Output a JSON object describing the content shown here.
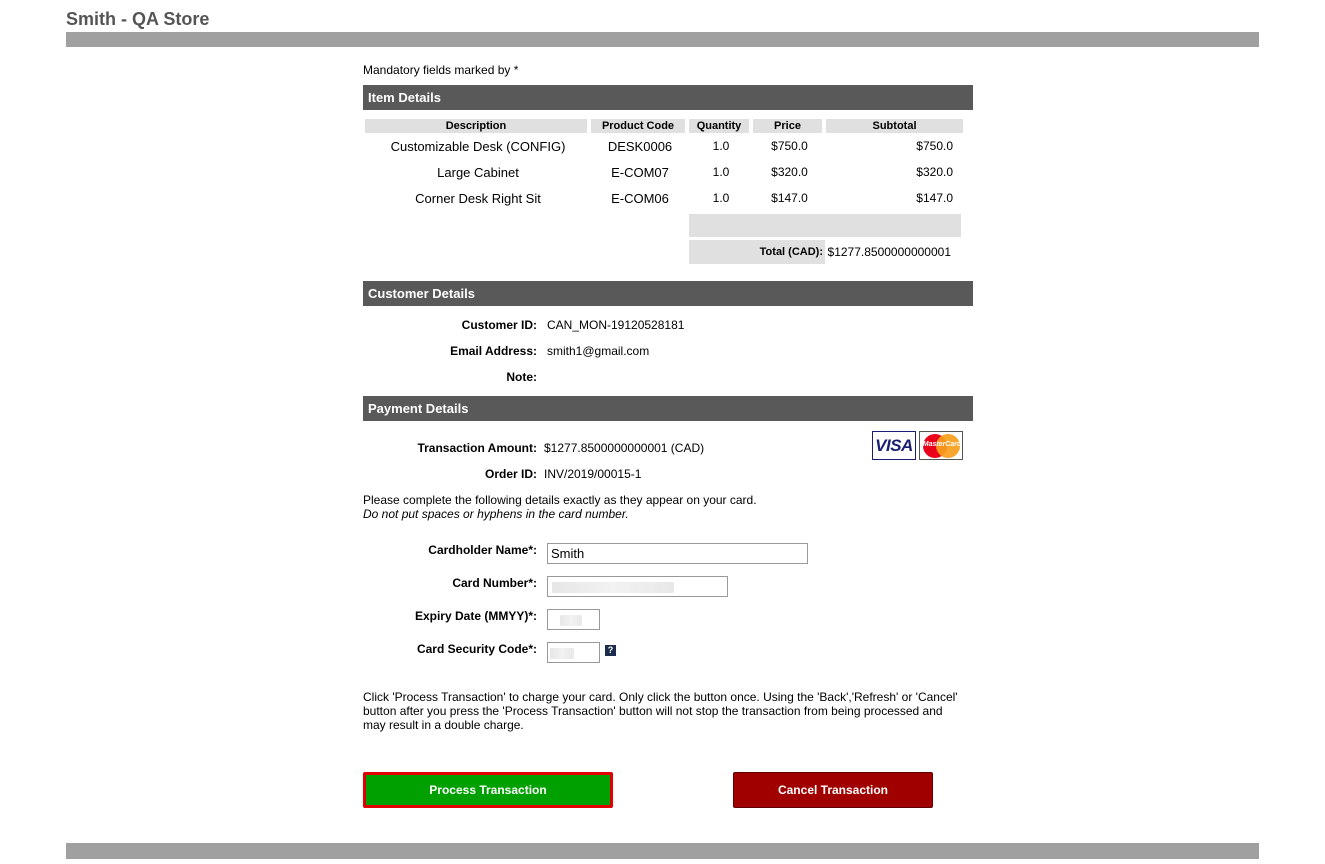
{
  "store": {
    "title": "Smith - QA Store"
  },
  "form": {
    "mandatory_note": "Mandatory fields marked by *"
  },
  "items": {
    "heading": "Item Details",
    "columns": [
      "Description",
      "Product Code",
      "Quantity",
      "Price",
      "Subtotal"
    ],
    "rows": [
      {
        "description": "Customizable Desk (CONFIG)",
        "code": "DESK0006",
        "quantity": "1.0",
        "price": "$750.0",
        "subtotal": "$750.0"
      },
      {
        "description": "Large Cabinet",
        "code": "E-COM07",
        "quantity": "1.0",
        "price": "$320.0",
        "subtotal": "$320.0"
      },
      {
        "description": "Corner Desk Right Sit",
        "code": "E-COM06",
        "quantity": "1.0",
        "price": "$147.0",
        "subtotal": "$147.0"
      }
    ],
    "total_label": "Total (CAD):",
    "total_value": "$1277.8500000000001"
  },
  "customer": {
    "heading": "Customer Details",
    "id_label": "Customer ID:",
    "id_value": "CAN_MON-19120528181",
    "email_label": "Email Address:",
    "email_value": "smith1@gmail.com",
    "note_label": "Note:",
    "note_value": ""
  },
  "payment": {
    "heading": "Payment Details",
    "amount_label": "Transaction Amount:",
    "amount_value": "$1277.8500000000001 (CAD)",
    "order_label": "Order ID:",
    "order_value": "INV/2019/00015-1",
    "cards": {
      "visa": "VISA",
      "mastercard": "MasterCard"
    },
    "instructions": "Please complete the following details exactly as they appear on your card.",
    "instructions_italic": "Do not put spaces or hyphens in the card number.",
    "cardholder_label": "Cardholder Name*:",
    "cardholder_value": "Smith",
    "card_number_label": "Card Number*:",
    "card_number_value": "",
    "expiry_label": "Expiry Date (MMYY)*:",
    "expiry_value": "",
    "cvc_label": "Card Security Code*:",
    "cvc_value": "",
    "help_glyph": "?",
    "notice": "Click 'Process Transaction' to charge your card. Only click the button once. Using the 'Back','Refresh' or 'Cancel' button after you press the 'Process Transaction' button will not stop the transaction from being processed and may result in a double charge."
  },
  "buttons": {
    "process": "Process Transaction",
    "cancel": "Cancel Transaction"
  },
  "colors": {
    "section_header": "#595959",
    "process_button": "#00a000",
    "process_border": "#e00000",
    "cancel_button": "#a00000",
    "bars": "#a0a0a0"
  }
}
